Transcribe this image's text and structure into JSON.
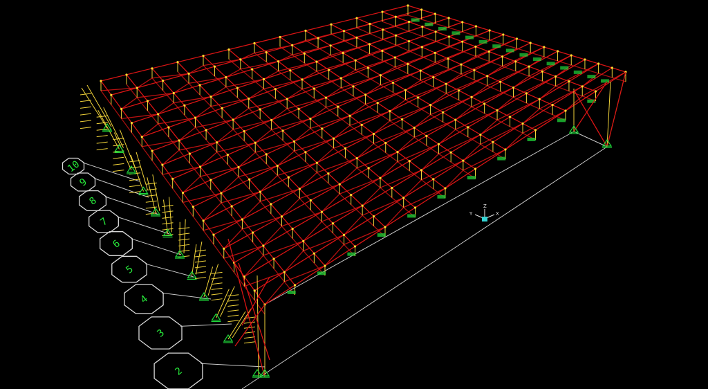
{
  "viewport": {
    "background": "#000000",
    "member_color": "#d81414",
    "vertical_member_color": "#f2d43a",
    "node_color": "#ffdf30",
    "gridline_color": "#c8c8c8",
    "bubble_label_color": "#27e83a",
    "support_color": "#1fd63a"
  },
  "grid_bubbles": [
    "2",
    "3",
    "4",
    "5",
    "6",
    "7",
    "8",
    "9",
    "10"
  ],
  "axis_triad": {
    "x": "X",
    "y": "Y",
    "z": "Z",
    "icon": "axis-triad-icon"
  }
}
